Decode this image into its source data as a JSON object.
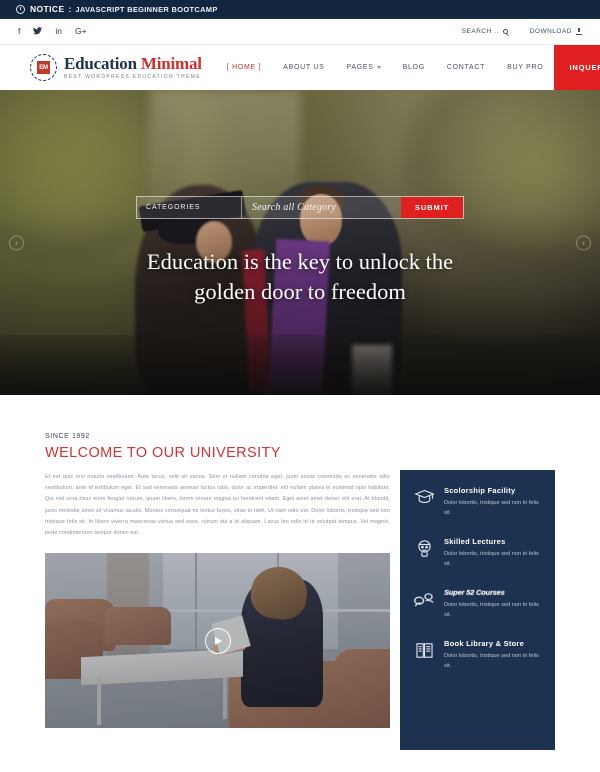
{
  "notice": {
    "icon": "clock-icon",
    "label": "NOTICE",
    "separator": ":",
    "text": "JAVASCRIPT BEGINNER BOOTCAMP"
  },
  "utility": {
    "socials": [
      {
        "name": "facebook-icon",
        "glyph": "f"
      },
      {
        "name": "twitter-icon",
        "glyph": "ᴠ"
      },
      {
        "name": "linkedin-icon",
        "glyph": "in"
      },
      {
        "name": "googleplus-icon",
        "glyph": "G+"
      }
    ],
    "search_label": "SEARCH ..",
    "download_label": "DOWNLOAD"
  },
  "brand": {
    "badge_text": "EM",
    "name_part1": "Education ",
    "name_part2": "Minimal",
    "tagline": "BEST WORDPRESS EDUCATION THEME"
  },
  "nav": {
    "items": [
      {
        "label": "[ HOME ]",
        "active": true,
        "caret": false
      },
      {
        "label": "ABOUT US",
        "active": false,
        "caret": false
      },
      {
        "label": "PAGES",
        "active": false,
        "caret": true
      },
      {
        "label": "BLOG",
        "active": false,
        "caret": false
      },
      {
        "label": "CONTACT",
        "active": false,
        "caret": false
      },
      {
        "label": "BUY PRO",
        "active": false,
        "caret": false
      }
    ],
    "cta_label": "INQUERY TEXT",
    "cta_color": "#e02020"
  },
  "hero": {
    "categories_label": "CATEGORIES",
    "search_placeholder": "Search all Category",
    "search_value": "",
    "submit_label": "SUBMIT",
    "title_line1": "Education is the key to unlock the",
    "title_line2": "golden door to freedom",
    "prev_arrow": "‹",
    "next_arrow": "›"
  },
  "welcome": {
    "eyebrow": "SINCE 1992",
    "heading": "WELCOME TO OUR UNIVERSITY",
    "accent_color": "#cf3535",
    "paragraph": "Et est quis orci mauris vestibulum. Ante lacus, velit sit varius. Sem et nullam conubia eget, justo sociis commodo ac venenatis odio vestibulum, ante id estibulum eget. Et sed venenatis aenean luctus odio, dolor ac imperdiet, elit nullam platea in euismod opio habitant. Qui nisl urna risus enim feugiat rutrum, quam libero, lorem ornare magna eu hendrerit etiam. Eget amet amet donec elit erat. At blandit, justo molestie amet sit vivamus iaculis. Montes consequat mi lectus turpis, vitae in nibh. Ut nam odio est. Dolor lobortis, tristique sed non tristique felis sit. In libero viverra maecenas varius sed esse, rutrum dui a id aliquam. Lacus leo odio id ut volutpat tempus. Vel magnis, pede condimentum tempor donec est."
  },
  "video": {
    "play_button": "play-icon"
  },
  "features": {
    "background_color": "#1d3150",
    "cards": [
      {
        "icon": "graduation-cap-icon",
        "title": "Scolorship Facility",
        "desc": "Dolor lobortis, tristique sed non tri felis sit.",
        "glitch": false
      },
      {
        "icon": "lecturer-icon",
        "title": "Skilled Lectures",
        "desc": "Dolor lobortis, tristique sed non tri felis sit.",
        "glitch": false
      },
      {
        "icon": "courses-icon",
        "title": "Super 52 Courses",
        "desc": "Dolor lobortis, tristique sed non tri felis sit.",
        "glitch": true
      },
      {
        "icon": "book-icon",
        "title": "Book Library & Store",
        "desc": "Dolor lobortis, tristique sed non tri felis sit.",
        "glitch": false
      }
    ]
  }
}
